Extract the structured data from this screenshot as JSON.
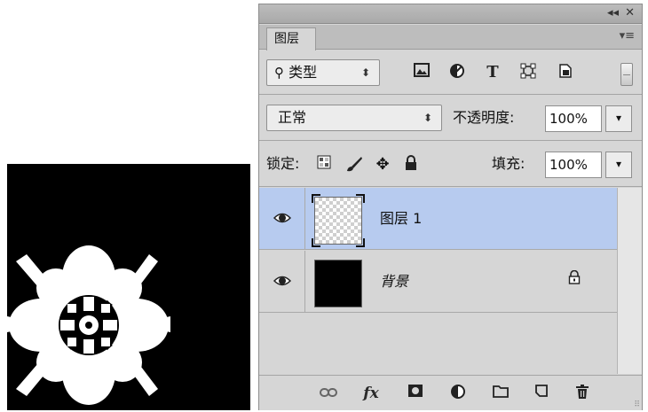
{
  "panel": {
    "title_controls": {
      "collapse": "◂◂",
      "close": "✕"
    },
    "tab_label": "图层",
    "menu_icon": "panel-menu-icon"
  },
  "filter": {
    "kind_label": "类型",
    "icons": [
      "image-filter-icon",
      "adjustment-filter-icon",
      "type-filter-icon",
      "shape-filter-icon",
      "smart-object-filter-icon"
    ]
  },
  "blend": {
    "mode": "正常",
    "opacity_label": "不透明度:",
    "opacity_value": "100%"
  },
  "lock": {
    "label": "锁定:",
    "icons": [
      "lock-transparent-pixels-icon",
      "lock-image-pixels-icon",
      "lock-position-icon",
      "lock-all-icon"
    ],
    "fill_label": "填充:",
    "fill_value": "100%"
  },
  "layers": [
    {
      "name": "图层 1",
      "selected": true,
      "visible": true,
      "thumbnail": "transparent",
      "locked": false
    },
    {
      "name": "背景",
      "selected": false,
      "visible": true,
      "thumbnail": "black",
      "locked": true
    }
  ],
  "bottom_toolbar": {
    "icons": [
      "link-layers-icon",
      "layer-style-fx-icon",
      "add-mask-icon",
      "new-adjustment-layer-icon",
      "new-group-icon",
      "new-layer-icon",
      "delete-layer-icon"
    ],
    "fx_label": "fx"
  },
  "colors": {
    "selected_layer": "#b7cbef",
    "panel_bg": "#d6d6d6",
    "canvas_bg": "#000000"
  }
}
